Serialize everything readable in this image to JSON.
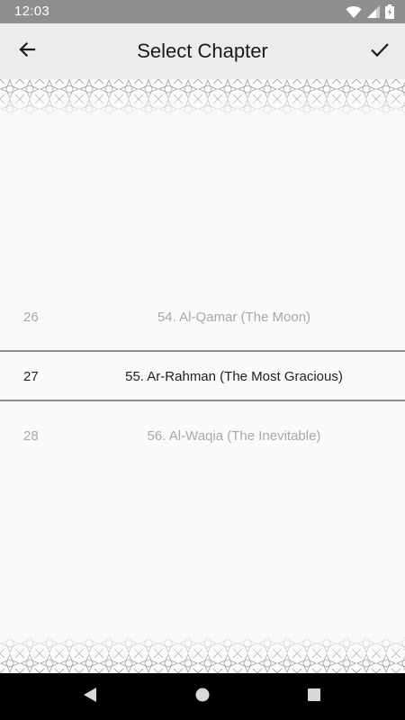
{
  "status_bar": {
    "time": "12:03",
    "icons": [
      "wifi-icon",
      "cell-signal-icon",
      "battery-icon"
    ]
  },
  "app_bar": {
    "title": "Select Chapter",
    "back_icon": "arrow-left-icon",
    "confirm_icon": "check-icon"
  },
  "picker": {
    "rows": [
      {
        "index": "26",
        "label": "54. Al-Qamar (The Moon)",
        "state": "faded"
      },
      {
        "index": "27",
        "label": "55. Ar-Rahman (The Most Gracious)",
        "state": "selected"
      },
      {
        "index": "28",
        "label": "56. Al-Waqia (The Inevitable)",
        "state": "faded"
      }
    ]
  },
  "nav_bar": {
    "buttons": [
      "nav-back-icon",
      "nav-home-icon",
      "nav-recents-icon"
    ]
  },
  "colors": {
    "status_bar": "#8e8e8e",
    "app_bar": "#ececec",
    "background": "#fafafa",
    "faded_text": "#a8a8a8",
    "selected_text": "#1f1f1f",
    "selection_line": "#8f8f8f",
    "nav_bar": "#000000"
  }
}
